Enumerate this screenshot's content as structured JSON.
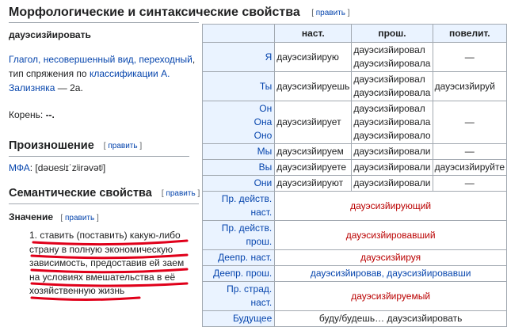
{
  "section_title": "Морфологические и синтаксические свойства",
  "edit_open": "[ ",
  "edit_close": " ]",
  "edit_label": "править",
  "lemma": "дауэсизйировать",
  "grammar": {
    "link1": "Глагол, несовершенный вид, переходный",
    "text1": ", тип спряжения по ",
    "link2": "классификации А. Зализняка",
    "text2": " — 2a."
  },
  "root": {
    "label": "Корень: ",
    "value": "--."
  },
  "pronunciation": {
    "heading": "Произношение",
    "ipa_label": "МФА",
    "ipa_value": ": [dəʊesʲɪˈzʲirəvətʲ]"
  },
  "semantics": {
    "heading": "Семантические свойства",
    "meaning_heading": "Значение",
    "meaning_number": "1.",
    "meaning_text": " ставить (поставить) какую-либо страну в полную экономическую зависимость, предоставив ей заем на условиях вмешательства в её хозяйственную жизнь"
  },
  "colors": {
    "header_bg": "#eaf3ff",
    "link": "#0645ad",
    "red_link": "#ba0000",
    "underline": "#e0001a"
  },
  "table": {
    "columns": [
      "наст.",
      "прош.",
      "повелит."
    ],
    "rows": [
      {
        "label": "Я",
        "pres": "дауэсизйирую",
        "past": [
          "дауэсизйировал",
          "дауэсизйировала"
        ],
        "imp": "—"
      },
      {
        "label": "Ты",
        "pres": "дауэсизйируешь",
        "past": [
          "дауэсизйировал",
          "дауэсизйировала"
        ],
        "imp": "дауэсизйируй"
      },
      {
        "label": [
          "Он",
          "Она",
          "Оно"
        ],
        "pres": "дауэсизйирует",
        "past": [
          "дауэсизйировал",
          "дауэсизйировала",
          "дауэсизйировало"
        ],
        "imp": "—"
      },
      {
        "label": "Мы",
        "pres": "дауэсизйируем",
        "past": [
          "дауэсизйировали"
        ],
        "imp": "—"
      },
      {
        "label": "Вы",
        "pres": "дауэсизйируете",
        "past": [
          "дауэсизйировали"
        ],
        "imp": "дауэсизйируйте"
      },
      {
        "label": "Они",
        "pres": "дауэсизйируют",
        "past": [
          "дауэсизйировали"
        ],
        "imp": "—"
      }
    ],
    "forms": [
      {
        "label": "Пр. действ. наст.",
        "value": "дауэсизйирующий"
      },
      {
        "label": "Пр. действ. прош.",
        "value": "дауэсизйировавший"
      },
      {
        "label": "Деепр. наст.",
        "value": "дауэсизйируя"
      },
      {
        "label": "Деепр. прош.",
        "value": "дауэсизйировав, дауэсизйировавши"
      },
      {
        "label": "Пр. страд. наст.",
        "value": "дауэсизйируемый"
      },
      {
        "label": "Будущее",
        "value": "буду/будешь… дауэсизйировать"
      }
    ]
  }
}
